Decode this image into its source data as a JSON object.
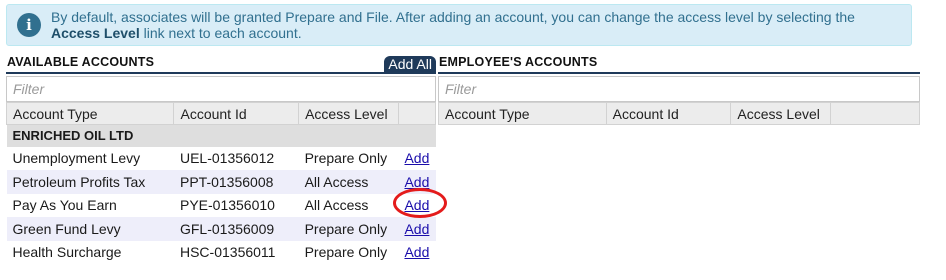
{
  "info": {
    "icon": "info-icon",
    "text_part1": "By default, associates will be granted Prepare and File. After adding an account, you can change the access level by selecting the",
    "link_term": "Access Level",
    "text_part2": "link next to each account."
  },
  "available": {
    "title": "AVAILABLE ACCOUNTS",
    "add_all_label": "Add All",
    "filter_placeholder": "Filter",
    "columns": [
      "Account Type",
      "Account Id",
      "Access Level",
      ""
    ],
    "group": "ENRICHED OIL LTD",
    "rows": [
      {
        "type": "Unemployment Levy",
        "id": "UEL-01356012",
        "access": "Prepare Only",
        "action": "Add"
      },
      {
        "type": "Petroleum Profits Tax",
        "id": "PPT-01356008",
        "access": "All Access",
        "action": "Add"
      },
      {
        "type": "Pay As You Earn",
        "id": "PYE-01356010",
        "access": "All Access",
        "action": "Add"
      },
      {
        "type": "Green Fund Levy",
        "id": "GFL-01356009",
        "access": "Prepare Only",
        "action": "Add"
      },
      {
        "type": "Health Surcharge",
        "id": "HSC-01356011",
        "access": "Prepare Only",
        "action": "Add"
      }
    ]
  },
  "employee": {
    "title": "EMPLOYEE'S ACCOUNTS",
    "filter_placeholder": "Filter",
    "columns": [
      "Account Type",
      "Account Id",
      "Access Level",
      ""
    ]
  },
  "colors": {
    "accent": "#1f3a5a",
    "info_bg": "#d9edf7",
    "link": "#1a0dab",
    "annotation": "#e41b1b"
  }
}
